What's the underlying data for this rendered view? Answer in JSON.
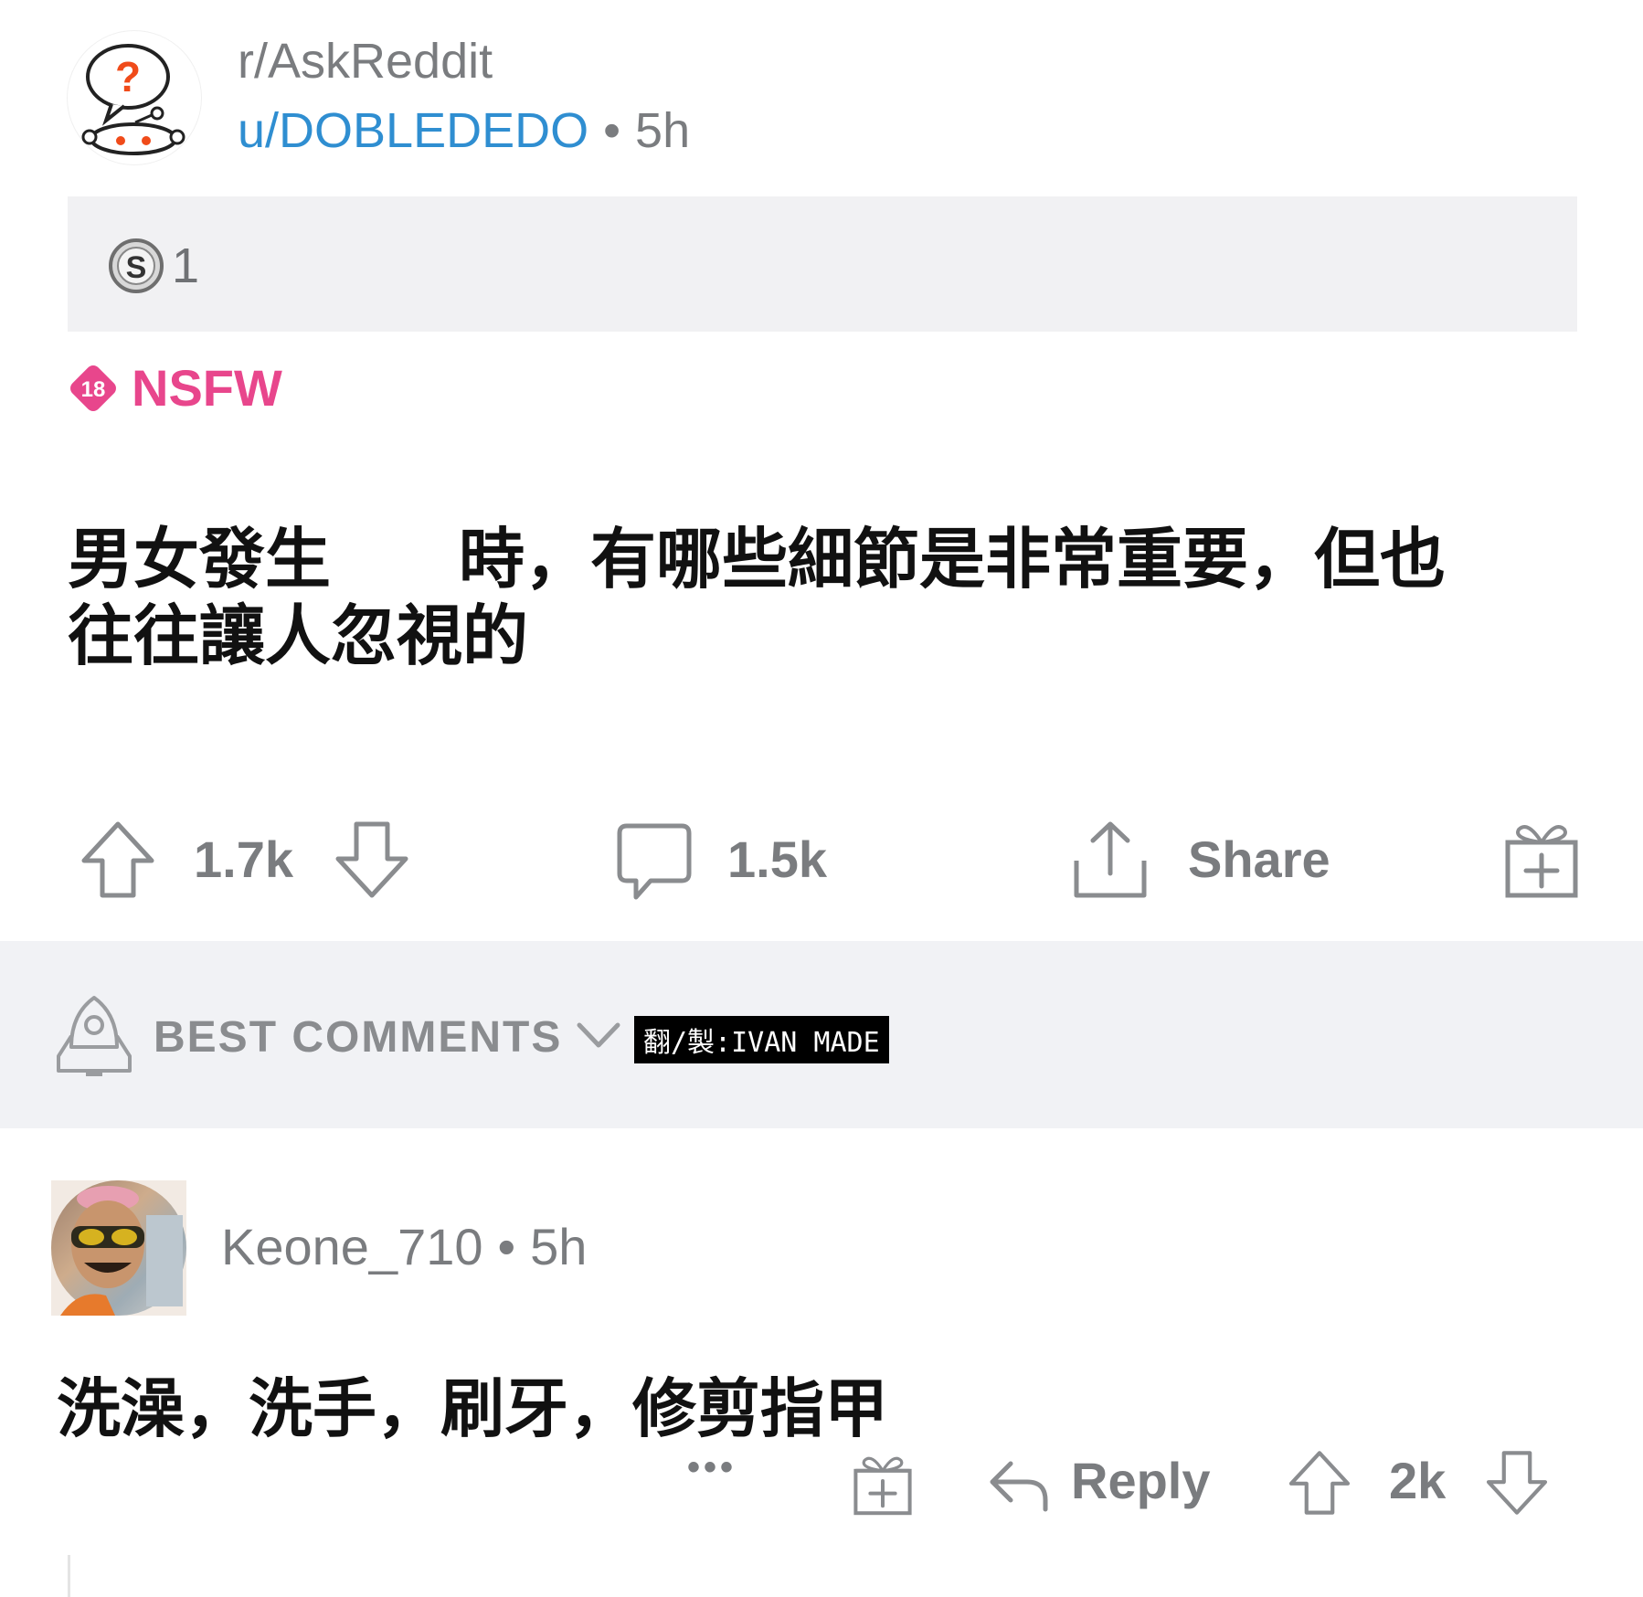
{
  "post": {
    "subreddit": "r/AskReddit",
    "author": "u/DOBLEDEDO",
    "separator": "•",
    "time": "5h",
    "award_count": "1",
    "nsfw_badge": "18",
    "nsfw_label": "NSFW",
    "title_part1": "男女發生",
    "title_part2": "時，有哪些細節是非常重要，但也往往讓人忽視的",
    "upvotes": "1.7k",
    "comments": "1.5k",
    "share_label": "Share"
  },
  "comments_header": {
    "sort_label": "BEST COMMENTS",
    "credit": "翻/製:IVAN MADE"
  },
  "comment": {
    "author": "Keone_710",
    "separator": "•",
    "time": "5h",
    "body": "洗澡，洗手，刷牙，修剪指甲",
    "more": "•••",
    "reply_label": "Reply",
    "score": "2k"
  },
  "colors": {
    "link_blue": "#2f8ed1",
    "nsfw_pink": "#e8468c",
    "muted_gray": "#7a7c7f",
    "band_gray": "#f1f2f5"
  }
}
